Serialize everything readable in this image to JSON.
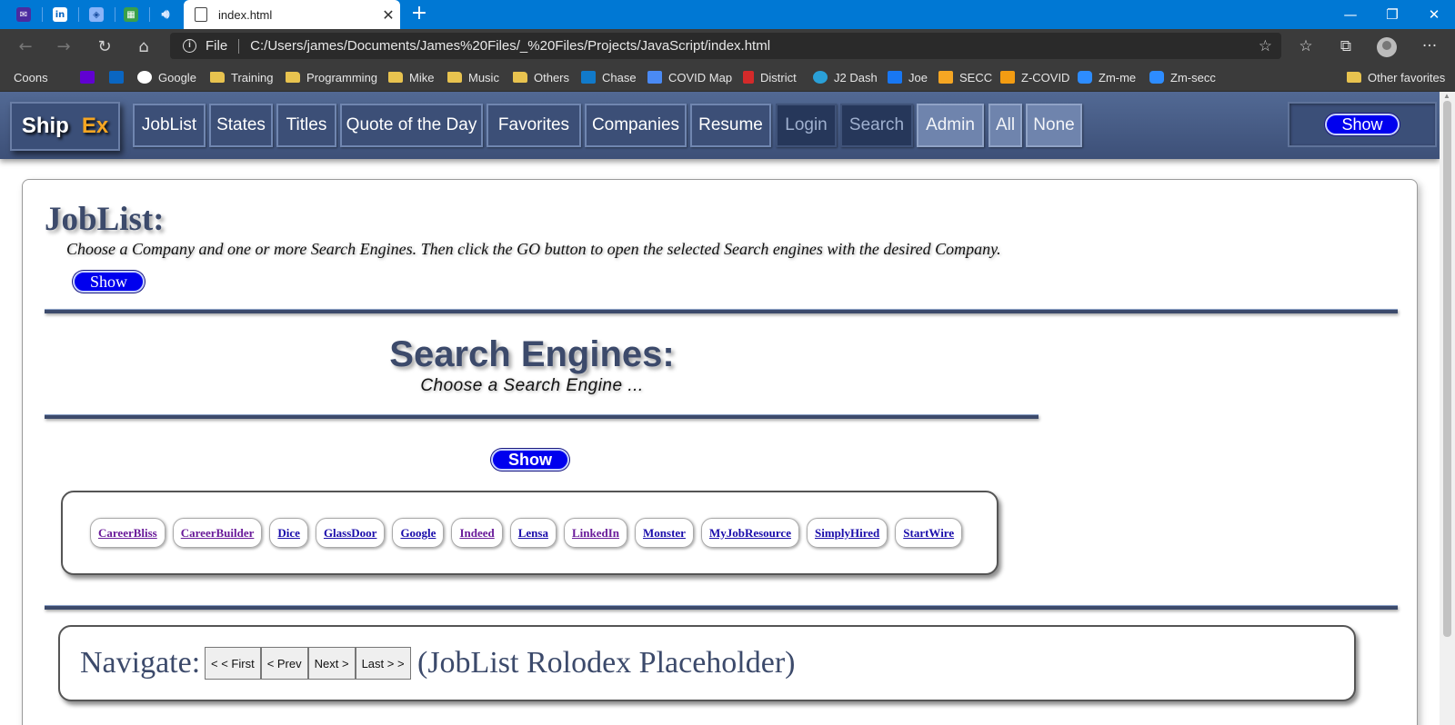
{
  "browser": {
    "tab_title": "index.html",
    "scheme": "File",
    "url": "C:/Users/james/Documents/James%20Files/_%20Files/Projects/JavaScript/index.html",
    "bookmarks": [
      "Coons",
      "Training",
      "Programming",
      "Mike",
      "Music",
      "Others",
      "Chase",
      "COVID Map",
      "District",
      "J2 Dash",
      "Joe",
      "SECC",
      "Z-COVID",
      "Zm-me",
      "Zm-secc"
    ],
    "other_favorites": "Other favorites"
  },
  "site": {
    "brand_1": "Ship",
    "brand_2": "Ex",
    "nav": [
      "JobList",
      "States",
      "Titles",
      "Quote of the Day",
      "Favorites",
      "Companies",
      "Resume",
      "Login",
      "Search",
      "Admin",
      "All",
      "None"
    ],
    "show": "Show"
  },
  "main": {
    "title": "JobList:",
    "subtitle": "Choose a Company and one or more Search Engines. Then click the GO button to open the selected Search engines with the desired Company.",
    "show": "Show",
    "search_title": "Search Engines:",
    "search_subtitle": "Choose a Search Engine ...",
    "search_show": "Show",
    "engines": [
      "CareerBliss",
      "CareerBuilder",
      "Dice",
      "GlassDoor",
      "Google",
      "Indeed",
      "Lensa",
      "LinkedIn",
      "Monster",
      "MyJobResource",
      "SimplyHired",
      "StartWire"
    ],
    "navigate_label": "Navigate:",
    "pager": [
      "< < First",
      "< Prev",
      "Next >",
      "Last > >"
    ],
    "placeholder": "(JobList Rolodex Placeholder)"
  },
  "colors": {
    "accent_blue": "#0000ee",
    "nav_bg": "#3d5078",
    "heading": "#3c4a6b",
    "brand_orange": "#f5a623"
  },
  "icons": [
    "mail-icon",
    "linkedin-icon",
    "app-icon",
    "spreadsheet-icon",
    "speaker-icon",
    "page-icon",
    "info-icon",
    "star-icon",
    "favorites-icon",
    "collections-icon",
    "profile-icon",
    "more-icon"
  ]
}
